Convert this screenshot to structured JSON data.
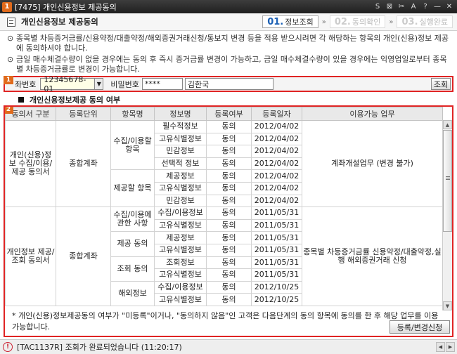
{
  "window": {
    "badge": "1",
    "title": "[7475] 개인신용정보 제공동의",
    "controls": [
      "S",
      "⊠",
      "✂",
      "A",
      "?",
      "—",
      "✕"
    ]
  },
  "header": {
    "title": "개인신용정보 제공동의",
    "steps": [
      {
        "num": "01.",
        "label": "정보조회",
        "state": "active"
      },
      {
        "num": "02.",
        "label": "동의확인",
        "state": "off"
      },
      {
        "num": "03.",
        "label": "실행완료",
        "state": "off"
      }
    ]
  },
  "notices": [
    "종목별 차등증거금률/신용약정/대출약정/해외증권거래신청/통보지 변경 등을 적용 받으시려면 각 해당하는 항목의 개인(신용)정보 제공에 동의하셔야 합니다.",
    "금일 매수체결수량이 없을 경우에는 동의 후 즉시 증거금률 변경이 가능하고, 금일 매수체결수량이 있을 경우에는 익영업일로부터 종목별 차등증거금률로 변경이 가능합니다."
  ],
  "query": {
    "badge": "1",
    "account_label": "좌번호",
    "account_value": "12345678-01",
    "password_label": "비밀번호",
    "password_value": "****",
    "name_value": "김한국",
    "query_button": "조회"
  },
  "section_title": "개인신용정보제공 동의 여부",
  "grid": {
    "badge": "2",
    "headers": [
      "동의서 구분",
      "등록단위",
      "항목명",
      "정보명",
      "등록여부",
      "등록일자",
      "이용가능 업무"
    ],
    "rows": [
      {
        "col0": "개인(신용)정보 수집/이용/제공 동의서",
        "col1": "종합계좌",
        "col2": "수집/이용할 항목",
        "col3": "필수적정보",
        "col4": "동의",
        "col5": "2012/04/02",
        "col6": "계좌개설업무 (변경 불가)"
      },
      {
        "col3": "고유식별정보",
        "col4": "동의",
        "col5": "2012/04/02"
      },
      {
        "col3": "민감정보",
        "col4": "동의",
        "col5": "2012/04/02"
      },
      {
        "col3": "선택적 정보",
        "col4": "동의",
        "col5": "2012/04/02"
      },
      {
        "col2": "제공할 항목",
        "col3": "제공정보",
        "col4": "동의",
        "col5": "2012/04/02"
      },
      {
        "col3": "고유식별정보",
        "col4": "동의",
        "col5": "2012/04/02"
      },
      {
        "col3": "민감정보",
        "col4": "동의",
        "col5": "2012/04/02"
      },
      {
        "col0": "개인정보 제공/조회 동의서",
        "col1": "종합계좌",
        "col2": "수집/이용에 관한 사항",
        "col3": "수집/이용정보",
        "col4": "동의",
        "col5": "2011/05/31",
        "col6": "종목별 차등증거금률 신용약정/대출약정,실행 해외증권거래 신청"
      },
      {
        "col3": "고유식별정보",
        "col4": "동의",
        "col5": "2011/05/31"
      },
      {
        "col2": "제공 동의",
        "col3": "제공정보",
        "col4": "동의",
        "col5": "2011/05/31"
      },
      {
        "col3": "고유식별정보",
        "col4": "동의",
        "col5": "2011/05/31"
      },
      {
        "col2": "조회 동의",
        "col3": "조회정보",
        "col4": "동의",
        "col5": "2011/05/31"
      },
      {
        "col3": "고유식별정보",
        "col4": "동의",
        "col5": "2011/05/31"
      },
      {
        "col2": "해외정보",
        "col3": "수집/이용정보",
        "col4": "동의",
        "col5": "2012/10/25"
      },
      {
        "col3": "고유식별정보",
        "col4": "동의",
        "col5": "2012/10/25"
      }
    ],
    "footnote": "* 개인(신용)정보제공동의 여부가 \"미등록\"이거나, \"동의하지 않음\"인 고객은  다음단계의 동의 항목에 동의를 한 후 해당 업무를 이용 가능합니다.",
    "apply_button": "등록/변경신청"
  },
  "status": {
    "icon": "!",
    "text": "[TAC1137R] 조회가 완료되었습니다 (11:20:17)"
  }
}
